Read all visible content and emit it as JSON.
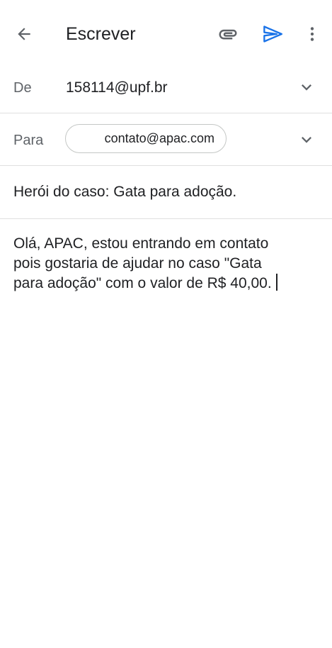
{
  "appbar": {
    "title": "Escrever",
    "icons": {
      "back": "arrow-back-icon",
      "attach": "paperclip-icon",
      "send": "send-icon",
      "more": "more-vert-icon"
    },
    "accent_color": "#1a73e8"
  },
  "from": {
    "label": "De",
    "value": "158114@upf.br"
  },
  "to": {
    "label": "Para",
    "recipient": "contato@apac.com"
  },
  "subject": {
    "value": "Herói do caso: Gata para adoção."
  },
  "body": {
    "lines": [
      "Olá, APAC, estou entrando em contato",
      "pois gostaria de ajudar no caso \"Gata",
      "para adoção\" com o valor de R$ 40,00."
    ]
  }
}
